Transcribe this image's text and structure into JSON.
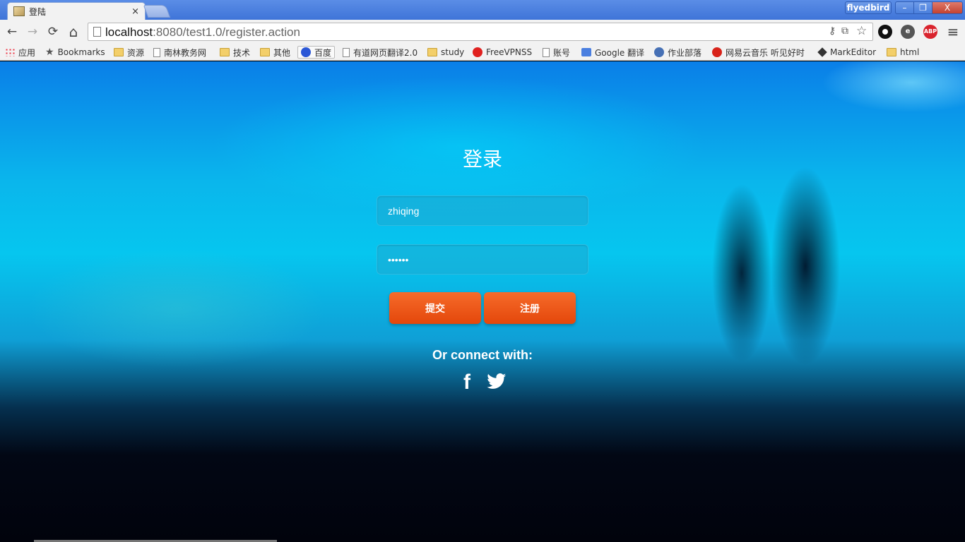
{
  "window": {
    "tab_title": "登陆",
    "tab_close": "×",
    "profile_name": "flyedbird",
    "minimize": "–",
    "maximize": "❐",
    "close": "X"
  },
  "toolbar": {
    "back": "←",
    "forward": "→",
    "reload": "⟳",
    "home": "⌂",
    "url_host": "localhost",
    "url_rest": ":8080/test1.0/register.action",
    "menu": "≡"
  },
  "bookmarks": [
    {
      "label": "应用",
      "icon": "apps-icon"
    },
    {
      "label": "Bookmarks",
      "icon": "star-icon"
    },
    {
      "label": "资源",
      "icon": "folder-icon"
    },
    {
      "label": "南林教务网",
      "icon": "doc-icon"
    },
    {
      "label": "技术",
      "icon": "folder-icon"
    },
    {
      "label": "其他",
      "icon": "folder-icon"
    },
    {
      "label": "百度",
      "icon": "baidu-icon"
    },
    {
      "label": "有道网页翻译2.0",
      "icon": "doc-icon"
    },
    {
      "label": "study",
      "icon": "folder-icon"
    },
    {
      "label": "FreeVPNSS",
      "icon": "freevpn-icon"
    },
    {
      "label": "账号",
      "icon": "doc-icon"
    },
    {
      "label": "Google 翻译",
      "icon": "google-translate-icon"
    },
    {
      "label": "作业部落",
      "icon": "zybl-icon"
    },
    {
      "label": "网易云音乐 听见好时",
      "icon": "netease-music-icon"
    },
    {
      "label": "MarkEditor",
      "icon": "markeditor-icon"
    },
    {
      "label": "html",
      "icon": "folder-icon"
    }
  ],
  "extensions": {
    "abp": "ABP"
  },
  "login": {
    "title": "登录",
    "username_value": "zhiqing",
    "password_value": "••••••",
    "submit_label": "提交",
    "register_label": "注册",
    "connect_text": "Or connect with:"
  },
  "colors": {
    "button_orange": "#e4470b",
    "titlebar_blue": "#3f74d8"
  }
}
